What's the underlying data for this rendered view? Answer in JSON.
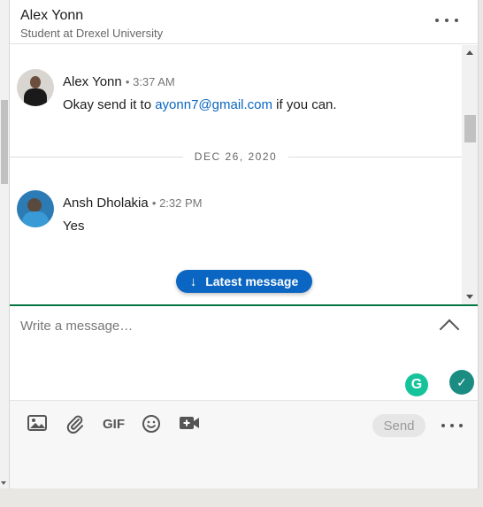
{
  "header": {
    "name": "Alex Yonn",
    "subtitle": "Student at Drexel University",
    "more_icon": "ellipsis-icon"
  },
  "messages": [
    {
      "sender": "Alex Yonn",
      "time": "• 3:37 AM",
      "text_before": "Okay send it to ",
      "link": "ayonn7@gmail.com",
      "text_after": " if you can."
    },
    {
      "sender": "Ansh Dholakia",
      "time": "• 2:32 PM",
      "text": "Yes"
    }
  ],
  "date_separator": "DEC 26, 2020",
  "latest_button": {
    "arrow": "↓",
    "label": "Latest message"
  },
  "compose": {
    "placeholder": "Write a message…",
    "expand_icon": "chevron-up-icon",
    "grammarly_letter": "G",
    "check_symbol": "✓"
  },
  "toolbar": {
    "gif_label": "GIF",
    "send_label": "Send",
    "icons": [
      "image-icon",
      "paperclip-icon",
      "gif-icon",
      "emoji-icon",
      "video-icon",
      "ellipsis-icon"
    ]
  },
  "colors": {
    "accent": "#0a66c2",
    "compose_border": "#057642",
    "grammarly": "#15c39a"
  }
}
